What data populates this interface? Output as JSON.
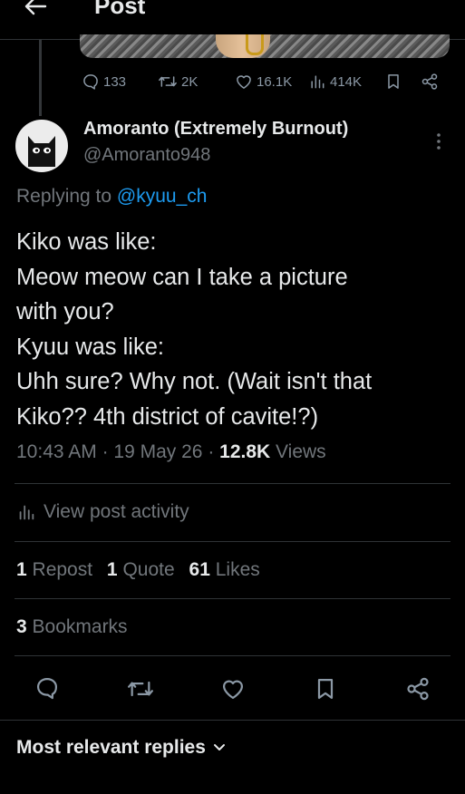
{
  "header": {
    "title": "Post"
  },
  "parent": {
    "stats": {
      "replies": "133",
      "reposts": "2K",
      "likes": "16.1K",
      "views": "414K"
    }
  },
  "post": {
    "display_name": "Amoranto (Extremely Burnout)",
    "handle": "@Amoranto948",
    "replying_prefix": "Replying to ",
    "replying_to": "@kyuu_ch",
    "lines": [
      "Kiko was like:",
      "Meow meow can I take a picture",
      "with you?",
      "Kyuu was like:",
      "Uhh sure? Why not. (Wait isn't that",
      "Kiko?? 4th district of cavite!?)"
    ],
    "time": "10:43 AM",
    "date": "19 May 26",
    "views_count": "12.8K",
    "views_label": "Views",
    "activity_label": "View post activity",
    "repost_count": "1",
    "repost_label": "Repost",
    "quote_count": "1",
    "quote_label": "Quote",
    "likes_count": "61",
    "likes_label": "Likes",
    "bookmarks_count": "3",
    "bookmarks_label": "Bookmarks"
  },
  "replies_sort": {
    "label": "Most relevant replies"
  },
  "colors": {
    "background": "#000000",
    "text": "#e7e9ea",
    "secondary": "#71767b",
    "link": "#1d9bf0",
    "divider": "#2f3336"
  }
}
